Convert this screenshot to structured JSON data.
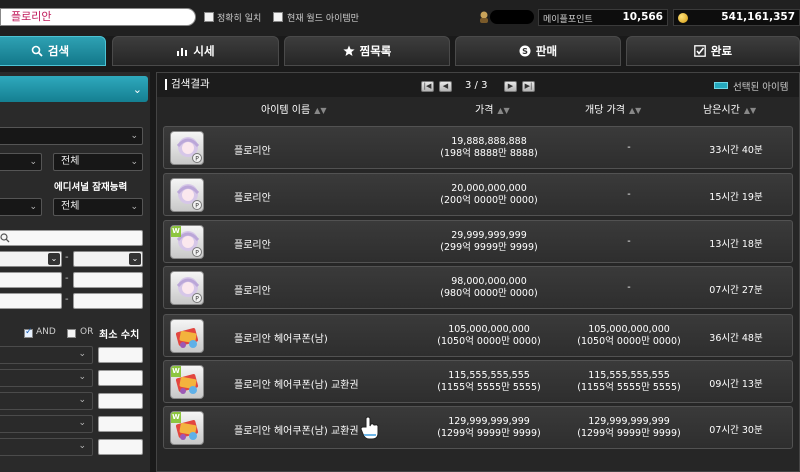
{
  "topbar": {
    "search_value": "플로리안",
    "exact_match_label": "정확히 일치",
    "world_only_label": "현재 월드 아이템만",
    "maple_point_label": "메이플포인트",
    "maple_point_value": "10,566",
    "meso_value": "541,161,357"
  },
  "tabs": [
    {
      "label": "검색",
      "icon": "search-icon"
    },
    {
      "label": "시세",
      "icon": "chart-icon"
    },
    {
      "label": "찜목록",
      "icon": "star-icon"
    },
    {
      "label": "판매",
      "icon": "sell-icon"
    },
    {
      "label": "완료",
      "icon": "check-icon"
    }
  ],
  "filters": {
    "all_1": "전체",
    "all_2": "전체",
    "additional_potential_label": "에디셔널 잠재능력",
    "and_label": "AND",
    "or_label": "OR",
    "min_value_label": "최소 수치"
  },
  "results": {
    "title": "검색결과",
    "page": "3 / 3",
    "selected_label": "선택된 아이템",
    "columns": {
      "name": "아이템 이름",
      "price": "가격",
      "unit_price": "개당 가격",
      "remaining": "남은시간"
    },
    "rows": [
      {
        "name": "플로리안",
        "price": "19,888,888,888",
        "price_kr": "(198억 8888만 8888)",
        "unit": "-",
        "unit_kr": "",
        "remaining": "33시간 40분",
        "tag": ""
      },
      {
        "name": "플로리안",
        "price": "20,000,000,000",
        "price_kr": "(200억 0000만 0000)",
        "unit": "-",
        "unit_kr": "",
        "remaining": "15시간 19분",
        "tag": ""
      },
      {
        "name": "플로리안",
        "price": "29,999,999,999",
        "price_kr": "(299억 9999만 9999)",
        "unit": "-",
        "unit_kr": "",
        "remaining": "13시간 18분",
        "tag": "W"
      },
      {
        "name": "플로리안",
        "price": "98,000,000,000",
        "price_kr": "(980억 0000만 0000)",
        "unit": "-",
        "unit_kr": "",
        "remaining": "07시간 27분",
        "tag": ""
      },
      {
        "name": "플로리안 헤어쿠폰(남)",
        "price": "105,000,000,000",
        "price_kr": "(1050억 0000만 0000)",
        "unit": "105,000,000,000",
        "unit_kr": "(1050억 0000만 0000)",
        "remaining": "36시간 48분",
        "tag": ""
      },
      {
        "name": "플로리안 헤어쿠폰(남) 교환권",
        "price": "115,555,555,555",
        "price_kr": "(1155억 5555만 5555)",
        "unit": "115,555,555,555",
        "unit_kr": "(1155억 5555만 5555)",
        "remaining": "09시간 13분",
        "tag": "W"
      },
      {
        "name": "플로리안 헤어쿠폰(남) 교환권",
        "price": "129,999,999,999",
        "price_kr": "(1299억 9999만 9999)",
        "unit": "129,999,999,999",
        "unit_kr": "(1299억 9999만 9999)",
        "remaining": "07시간 30분",
        "tag": "W"
      }
    ]
  },
  "colors": {
    "accent": "#1f95a8",
    "background": "#1a1a1a",
    "row_bg": "#333333"
  }
}
